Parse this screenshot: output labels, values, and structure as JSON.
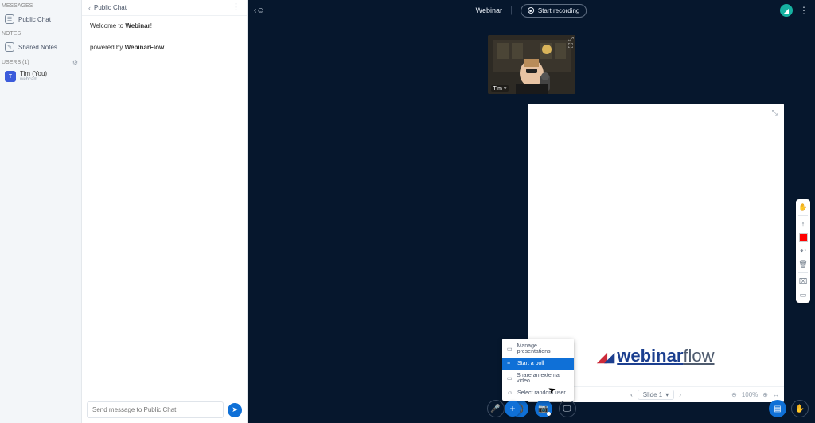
{
  "sidebar": {
    "messages_header": "MESSAGES",
    "public_chat_label": "Public Chat",
    "notes_header": "NOTES",
    "shared_notes_label": "Shared Notes",
    "users_header": "USERS (1)",
    "user": {
      "name": "Tim (You)",
      "status": "webcam",
      "initial": "T"
    }
  },
  "chat": {
    "back_icon": "‹",
    "title": "Public Chat",
    "welcome_prefix": "Welcome to ",
    "welcome_bold": "Webinar",
    "welcome_suffix": "!",
    "powered_prefix": "powered by ",
    "powered_bold": "WebinarFlow",
    "input_placeholder": "Send message to Public Chat",
    "send_icon": "➤"
  },
  "header": {
    "session_name": "Webinar",
    "record_label": "Start recording"
  },
  "webcam": {
    "name": "Tim"
  },
  "presentation": {
    "brand_word1": "webinar",
    "brand_word2": "flow",
    "footer": {
      "slide_label": "Slide 1",
      "zoom": "100%"
    }
  },
  "actions_menu": {
    "items": [
      {
        "icon": "▭",
        "label": "Manage presentations"
      },
      {
        "icon": "≡",
        "label": "Start a poll"
      },
      {
        "icon": "▭",
        "label": "Share an external video"
      },
      {
        "icon": "☺",
        "label": "Select random user"
      }
    ],
    "selected_index": 1
  },
  "toolbar": {
    "tools": [
      "hand",
      "pointer",
      "color",
      "undo",
      "trash",
      "text",
      "more"
    ]
  }
}
